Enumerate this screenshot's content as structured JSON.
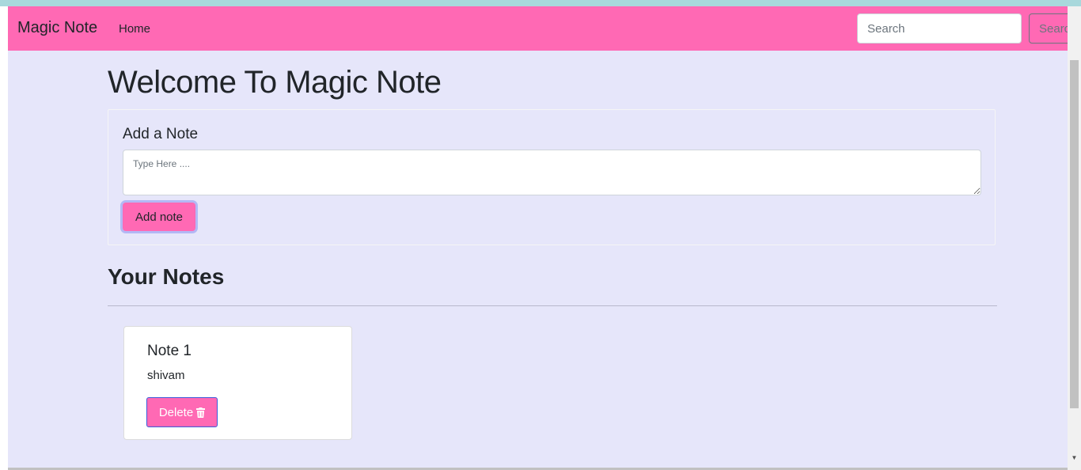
{
  "navbar": {
    "brand": "Magic Note",
    "home_label": "Home",
    "search_placeholder": "Search",
    "search_button_label": "Search"
  },
  "page_title": "Welcome To Magic Note",
  "add_note": {
    "title": "Add a Note",
    "textarea_placeholder": "Type Here ....",
    "button_label": "Add note"
  },
  "notes_section": {
    "title": "Your Notes",
    "notes": [
      {
        "title": "Note 1",
        "text": "shivam",
        "delete_label": "Delete"
      }
    ]
  },
  "colors": {
    "navbar": "#ff69b4",
    "background": "#e6e6fa",
    "accent_border": "#3a5bd9"
  },
  "icons": {
    "delete": "trash-icon",
    "scroll_down": "chevron-down-icon"
  }
}
